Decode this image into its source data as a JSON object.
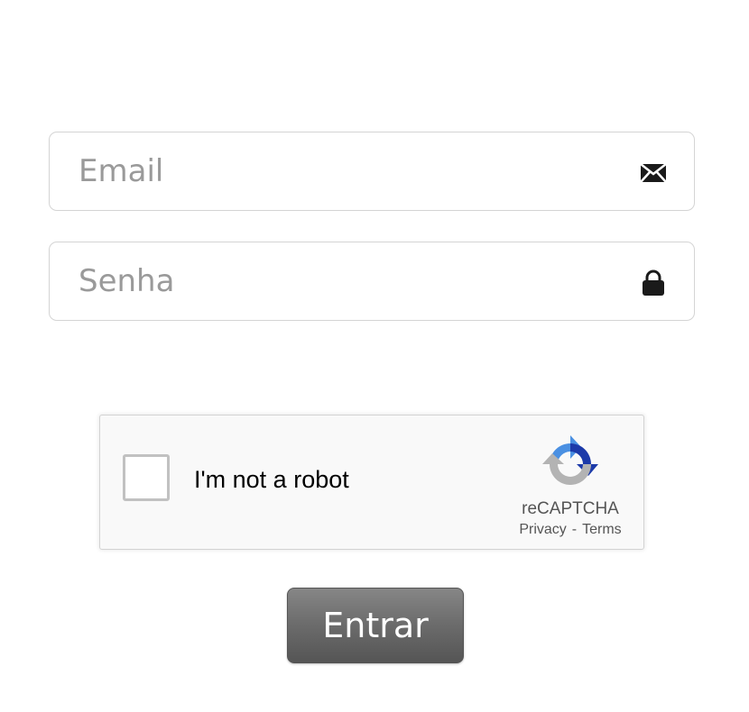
{
  "form": {
    "email": {
      "placeholder": "Email",
      "value": "",
      "icon": "envelope-icon"
    },
    "password": {
      "placeholder": "Senha",
      "value": "",
      "icon": "lock-icon"
    },
    "recaptcha": {
      "label": "I'm not a robot",
      "brand": "reCAPTCHA",
      "privacy_link": "Privacy",
      "separator": "-",
      "terms_link": "Terms",
      "checked": false
    },
    "submit_label": "Entrar"
  },
  "colors": {
    "placeholder_text": "#9a9a9a",
    "field_border": "#d4d4d4",
    "button_top": "#868686",
    "button_bottom": "#555555",
    "recaptcha_background": "#f9f9f9",
    "recaptcha_blue": "#4a90e2",
    "recaptcha_dark_blue": "#1c3aa9",
    "recaptcha_gray": "#b3b3b3"
  }
}
